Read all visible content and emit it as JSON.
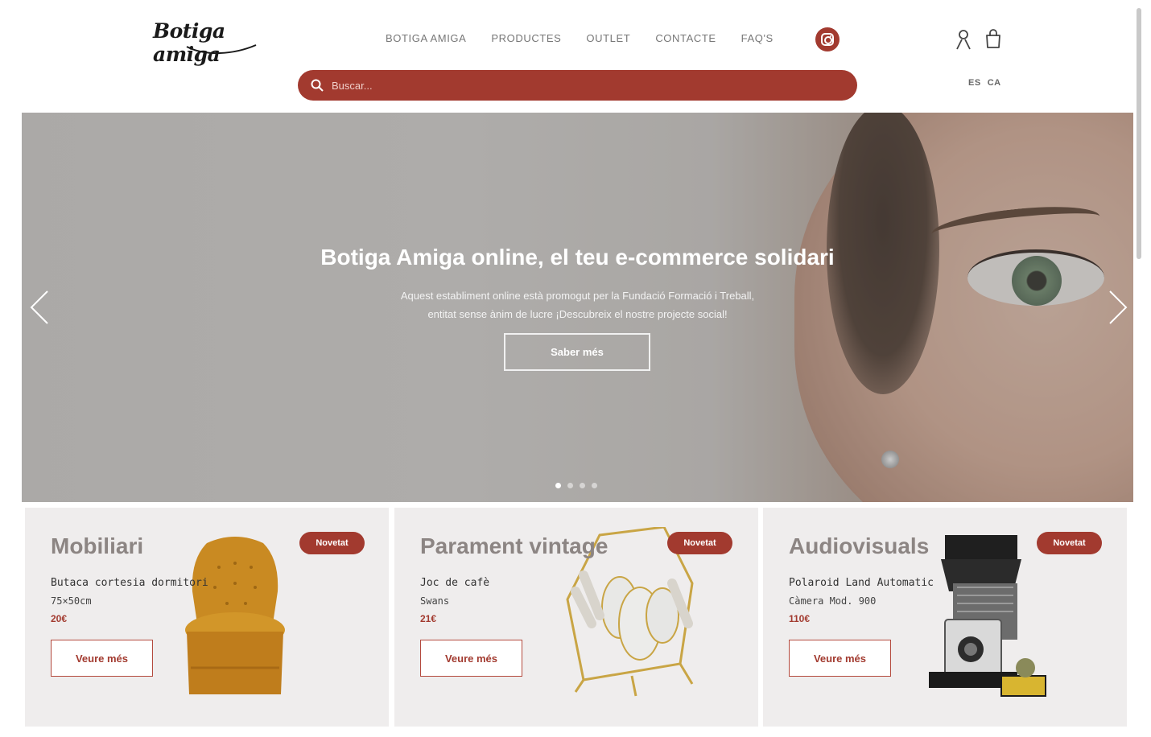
{
  "header": {
    "logo_text": "Botiga amiga",
    "nav": [
      "BOTIGA AMIGA",
      "PRODUCTES",
      "OUTLET",
      "CONTACTE",
      "FAQ'S"
    ],
    "search_placeholder": "Buscar...",
    "languages": [
      "ES",
      "CA"
    ]
  },
  "hero": {
    "title": "Botiga Amiga online, el teu e-commerce solidari",
    "subtitle_line1": "Aquest establiment online està promogut per la Fundació Formació i Treball,",
    "subtitle_line2": "entitat sense ànim de lucre ¡Descubreix el nostre projecte social!",
    "button_label": "Saber més",
    "slide_count": 4,
    "active_slide": 1
  },
  "cards": [
    {
      "title": "Mobiliari",
      "badge": "Novetat",
      "name": "Butaca cortesia dormitori",
      "desc": "75×50cm",
      "price": "20€",
      "button": "Veure més"
    },
    {
      "title": "Parament vintage",
      "badge": "Novetat",
      "name": "Joc de cafè",
      "desc": "Swans",
      "price": "21€",
      "button": "Veure més"
    },
    {
      "title": "Audiovisuals",
      "badge": "Novetat",
      "name": "Polaroid Land Automatic",
      "desc": "Càmera Mod. 900",
      "price": "110€",
      "button": "Veure més"
    }
  ],
  "colors": {
    "accent": "#a23a2f",
    "card_bg": "#efeded",
    "title_grey": "#8c8583"
  },
  "icons": [
    "search-icon",
    "instagram-icon",
    "user-icon",
    "shopping-bag-icon",
    "chevron-left-icon",
    "chevron-right-icon"
  ]
}
